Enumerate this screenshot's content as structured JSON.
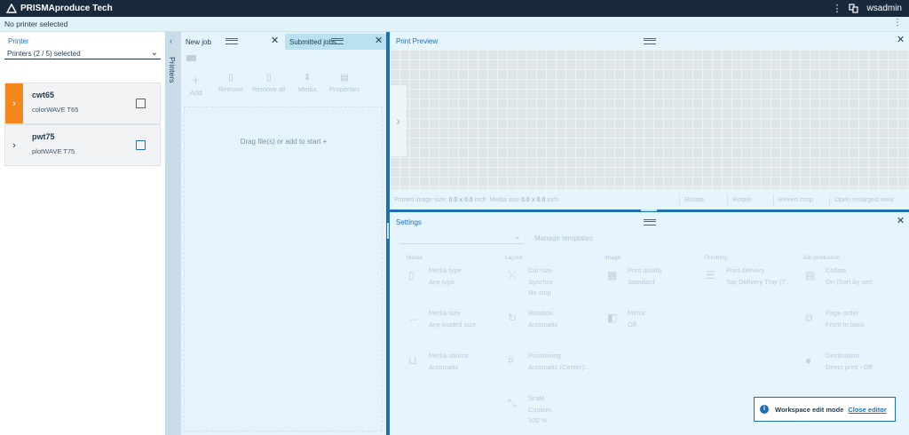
{
  "app": {
    "title": "PRISMAproduce Tech",
    "user": "wsadmin"
  },
  "status": {
    "text": "No printer selected"
  },
  "printers": {
    "label": "Printer",
    "selected": "Printers (2 / 5) selected",
    "items": [
      {
        "name": "cwt65",
        "model": "colorWAVE T65",
        "active": true
      },
      {
        "name": "pwt75",
        "model": "plotWAVE T75",
        "active": false
      }
    ],
    "tab_label": "Printers"
  },
  "jobs": {
    "tab_new": "New job",
    "tab_submitted": "Submitted jobs",
    "toolbar": {
      "add": "Add",
      "remove": "Remove",
      "remove_all": "Remove all",
      "media": "Media",
      "properties": "Properties"
    },
    "drop_text": "Drag file(s) or add to start +"
  },
  "preview": {
    "title": "Print Preview",
    "printed_label": "Printed image size:",
    "printed_value": "0.0 x 0.0",
    "printed_unit": "inch",
    "media_label": "Media size",
    "media_value": "0.0 x 0.0",
    "media_unit": "inch",
    "rotate_left": "Rotate",
    "rotate_right": "Rotate",
    "revert_crop": "Revert crop",
    "open_enlarged": "Open enlarged view"
  },
  "settings": {
    "title": "Settings",
    "manage": "Manage templates",
    "columns": [
      "Media",
      "Layout",
      "Image",
      "Finishing",
      "Job production"
    ],
    "cards": {
      "media_type": {
        "title": "Media type",
        "value": "Any type"
      },
      "media_size": {
        "title": "Media size",
        "value": "Any loaded size"
      },
      "media_source": {
        "title": "Media source",
        "value": "Automatic"
      },
      "cut_size": {
        "title": "Cut size",
        "value": "Synchro",
        "value2": "No strip"
      },
      "rotation": {
        "title": "Rotation",
        "value": "Automatic"
      },
      "positioning": {
        "title": "Positioning",
        "value": "Automatic (Center)..."
      },
      "scale": {
        "title": "Scale",
        "value": "Custom",
        "value2": "100 %"
      },
      "print_quality": {
        "title": "Print quality",
        "value": "Standard"
      },
      "mirror": {
        "title": "Mirror",
        "value": "Off"
      },
      "print_delivery": {
        "title": "Print delivery",
        "value": "Top Delivery Tray (T..."
      },
      "collate": {
        "title": "Collate",
        "value": "On (Sort by set)"
      },
      "page_order": {
        "title": "Page order",
        "value": "Front to back"
      },
      "destination": {
        "title": "Destination",
        "value": "Direct print - Off"
      }
    }
  },
  "edit_mode": {
    "text": "Workspace edit mode",
    "close": "Close editor"
  }
}
